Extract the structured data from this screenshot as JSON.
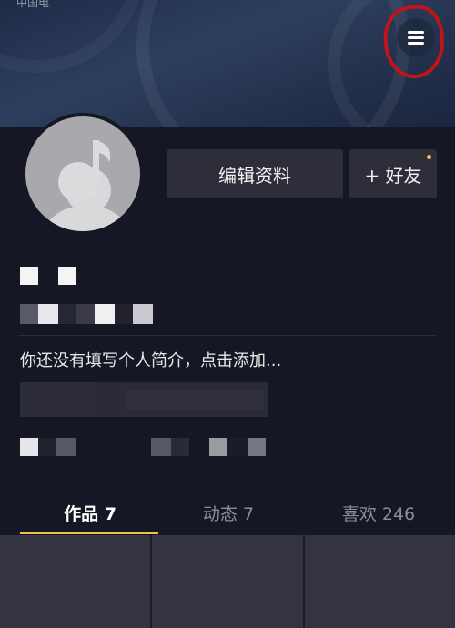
{
  "header": {
    "status_partial": "中国电"
  },
  "actions": {
    "edit_profile": "编辑资料",
    "add_friend": "+ 好友"
  },
  "profile": {
    "bio": "你还没有填写个人简介，点击添加..."
  },
  "tabs": [
    {
      "label": "作品 7"
    },
    {
      "label": "动态 7"
    },
    {
      "label": "喜欢 246"
    }
  ],
  "colors": {
    "background": "#161724",
    "accent": "#f5c04a",
    "annotation": "#c0141a"
  },
  "icons": {
    "menu": "menu-icon",
    "avatar": "default-avatar-icon"
  }
}
